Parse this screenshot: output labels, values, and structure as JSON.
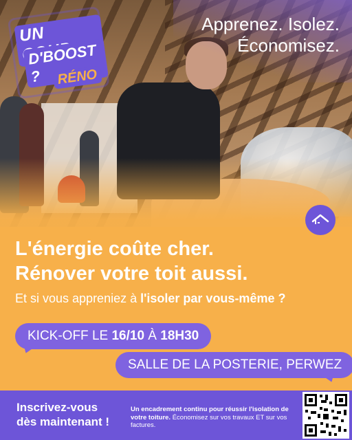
{
  "logo": {
    "line1": "UN COUP",
    "line2": "D'BOOST ?",
    "line3": "RÉNO"
  },
  "tagline": {
    "line1": "Apprenez. Isolez.",
    "line2": "Économisez."
  },
  "headline": {
    "line1": "L'énergie coûte cher.",
    "line2": "Rénover votre toit aussi."
  },
  "subline": {
    "prefix": "Et si vous appreniez à ",
    "bold": "l'isoler par vous-même ?"
  },
  "event": {
    "kickoff_prefix": "KICK-OFF LE ",
    "date": "16/10",
    "at": " À ",
    "time": "18H30",
    "location": "SALLE DE LA POSTERIE, PERWEZ"
  },
  "footer": {
    "cta_line1": "Inscrivez-vous",
    "cta_line2": "dès maintenant !",
    "text_bold": "Un encadrement continu pour réussir l'isolation de votre toiture.",
    "text_normal": " Économisez sur vos travaux ET sur vos factures."
  },
  "icons": {
    "house": "house-roof-icon",
    "qr": "qr-code-icon"
  },
  "colors": {
    "orange": "#f7b04a",
    "purple": "#6d55d8",
    "pill_purple": "#7f63e0"
  }
}
